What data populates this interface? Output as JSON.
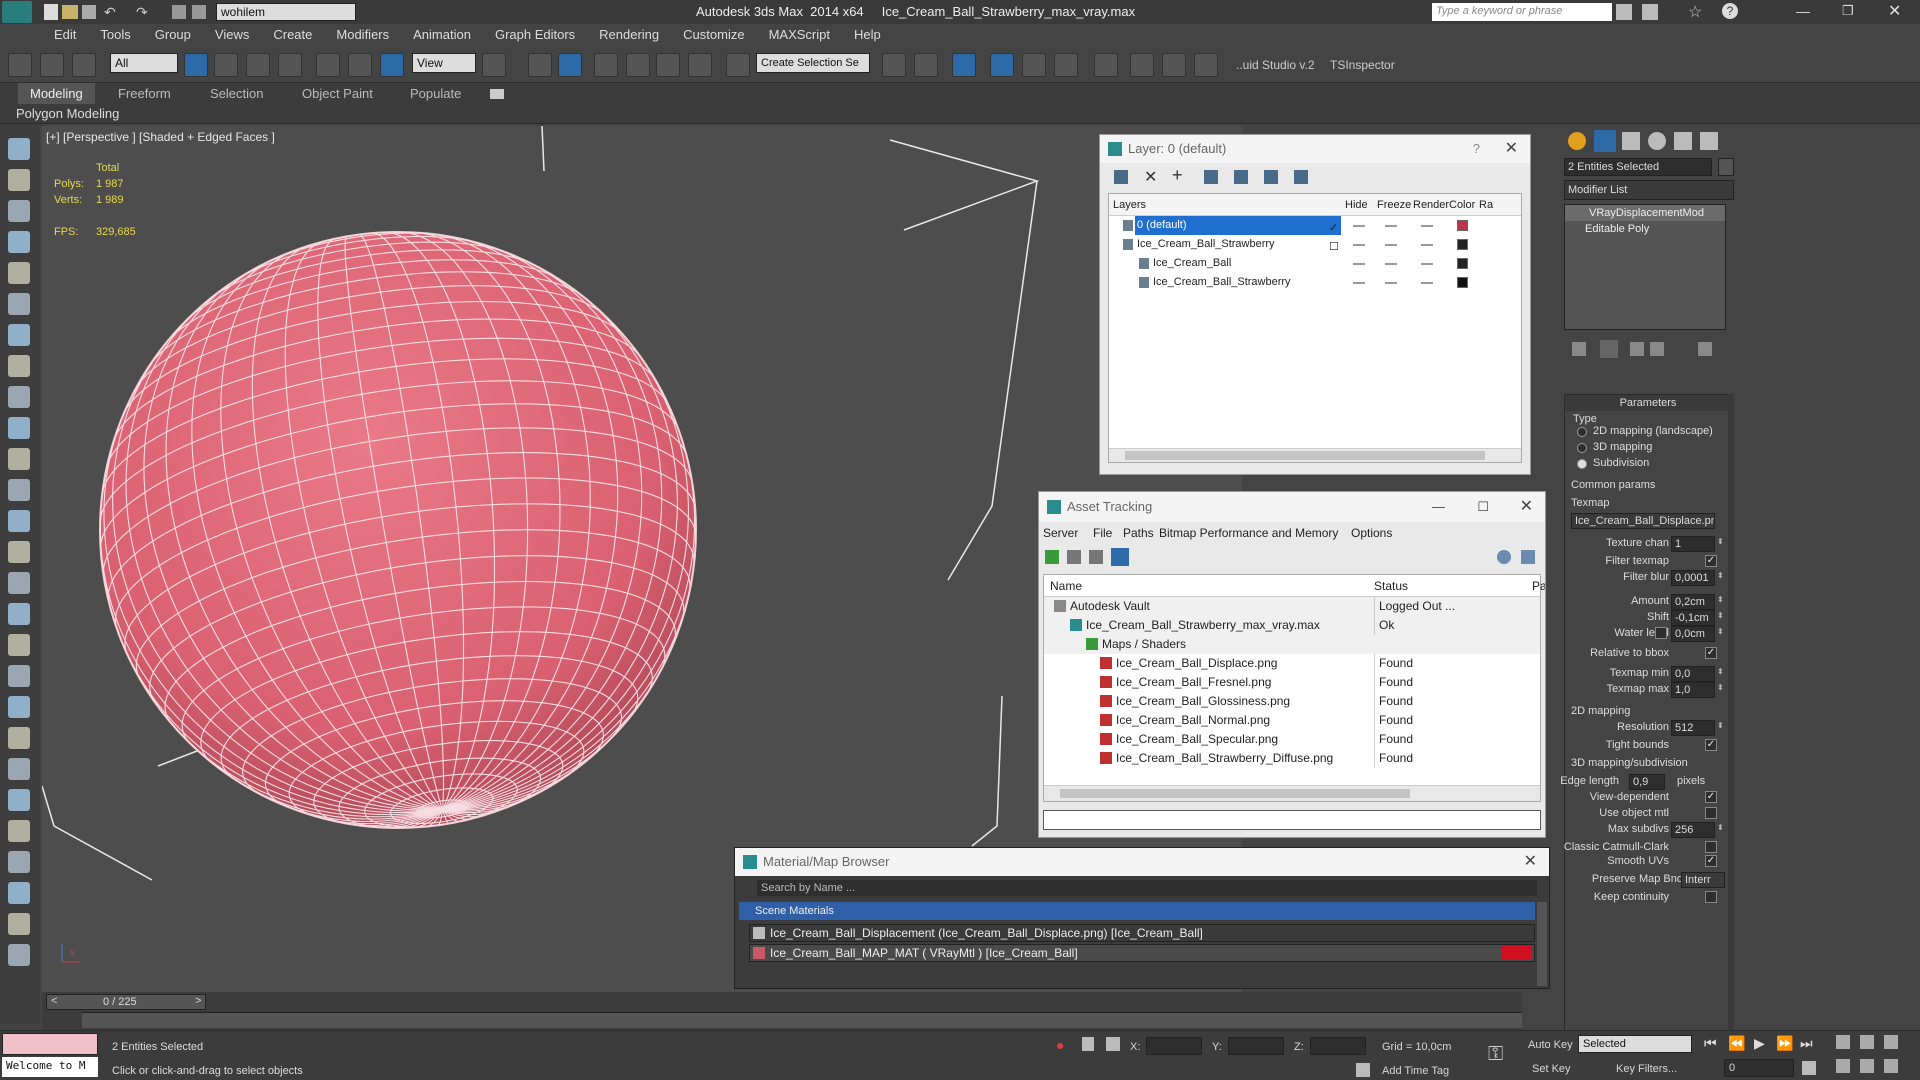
{
  "app": {
    "title": "Autodesk 3ds Max  2014 x64     Ice_Cream_Ball_Strawberry_max_vray.max",
    "workspace": "wohilem",
    "search_placeholder": "Type a keyword or phrase"
  },
  "menu": [
    "Edit",
    "Tools",
    "Group",
    "Views",
    "Create",
    "Modifiers",
    "Animation",
    "Graph Editors",
    "Rendering",
    "Customize",
    "MAXScript",
    "Help"
  ],
  "toolbar": {
    "selection_filter": "All",
    "ref_coord": "View",
    "named_selection": "Create Selection Se",
    "plugin_1": "..uid Studio v.2",
    "plugin_2": "TSInspector"
  },
  "ribbon": {
    "tabs": [
      "Modeling",
      "Freeform",
      "Selection",
      "Object Paint",
      "Populate"
    ],
    "active": "Modeling",
    "sub_label": "Polygon Modeling"
  },
  "viewport": {
    "label": "[+] [Perspective ] [Shaded + Edged Faces ]",
    "stats_header": "Total",
    "polys_label": "Polys:",
    "polys": "1 987",
    "verts_label": "Verts:",
    "verts": "1 989",
    "fps_label": "FPS:",
    "fps": "329,685",
    "object_color": "#e06a78"
  },
  "layers": {
    "title": "Layer: 0 (default)",
    "columns": [
      "Layers",
      "Hide",
      "Freeze",
      "Render",
      "Color",
      "Ra"
    ],
    "rows": [
      {
        "name": "0 (default)",
        "selected": true,
        "color": "#c0304a"
      },
      {
        "name": "Ice_Cream_Ball_Strawberry",
        "selected": false,
        "color": "#222222"
      },
      {
        "name": "Ice_Cream_Ball",
        "selected": false,
        "color": "#222222"
      },
      {
        "name": "Ice_Cream_Ball_Strawberry",
        "selected": false,
        "color": "#111111"
      }
    ]
  },
  "asset_tracking": {
    "title": "Asset Tracking",
    "menu": [
      "Server",
      "File",
      "Paths",
      "Bitmap Performance and Memory",
      "Options"
    ],
    "columns": [
      "Name",
      "Status",
      "Pa"
    ],
    "rows": [
      {
        "name": "Autodesk Vault",
        "status": "Logged Out ..."
      },
      {
        "name": "Ice_Cream_Ball_Strawberry_max_vray.max",
        "status": "Ok"
      },
      {
        "name": "Maps / Shaders",
        "status": ""
      },
      {
        "name": "Ice_Cream_Ball_Displace.png",
        "status": "Found"
      },
      {
        "name": "Ice_Cream_Ball_Fresnel.png",
        "status": "Found"
      },
      {
        "name": "Ice_Cream_Ball_Glossiness.png",
        "status": "Found"
      },
      {
        "name": "Ice_Cream_Ball_Normal.png",
        "status": "Found"
      },
      {
        "name": "Ice_Cream_Ball_Specular.png",
        "status": "Found"
      },
      {
        "name": "Ice_Cream_Ball_Strawberry_Diffuse.png",
        "status": "Found"
      }
    ]
  },
  "material_browser": {
    "title": "Material/Map Browser",
    "search_placeholder": "Search by Name ...",
    "group": "Scene Materials",
    "items": [
      "Ice_Cream_Ball_Displacement (Ice_Cream_Ball_Displace.png) [Ice_Cream_Ball]",
      "Ice_Cream_Ball_MAP_MAT  ( VRayMtl ) [Ice_Cream_Ball]"
    ]
  },
  "command_panel": {
    "selection": "2 Entities Selected",
    "modifier_list": "Modifier List",
    "stack": [
      "VRayDisplacementMod",
      "Editable Poly"
    ],
    "params_header": "Parameters",
    "type_label": "Type",
    "type_options": [
      "2D mapping (landscape)",
      "3D mapping",
      "Subdivision"
    ],
    "type_selected": "Subdivision",
    "common_label": "Common params",
    "texmap_label": "Texmap",
    "texmap": "Ice_Cream_Ball_Displace.png)",
    "texture_chan_label": "Texture chan",
    "texture_chan": "1",
    "filter_texmap_label": "Filter texmap",
    "filter_blur_label": "Filter blur",
    "filter_blur": "0,0001",
    "amount_label": "Amount",
    "amount": "0,2cm",
    "shift_label": "Shift",
    "shift": "-0,1cm",
    "water_label": "Water level",
    "water": "0,0cm",
    "relative_label": "Relative to bbox",
    "texmap_min_label": "Texmap min",
    "texmap_min": "0,0",
    "texmap_max_label": "Texmap max",
    "texmap_max": "1,0",
    "mapping2d_label": "2D mapping",
    "resolution_label": "Resolution",
    "resolution": "512",
    "tight_label": "Tight bounds",
    "mapping3d_label": "3D mapping/subdivision",
    "edge_label": "Edge length",
    "edge": "0,9",
    "pixels": "pixels",
    "view_dep_label": "View-dependent",
    "use_obj_label": "Use object mtl",
    "max_subdivs_label": "Max subdivs",
    "max_subdivs": "256",
    "catmull_label": "Classic Catmull-Clark",
    "smooth_label": "Smooth UVs",
    "preserve_label": "Preserve Map Bnd",
    "preserve": "Interr",
    "keep_label": "Keep continuity"
  },
  "timeline": {
    "frame": "0 / 225"
  },
  "status": {
    "maxscript": "Welcome to M",
    "selected": "2 Entities Selected",
    "prompt": "Click or click-and-drag to select objects",
    "x_label": "X:",
    "y_label": "Y:",
    "z_label": "Z:",
    "grid": "Grid = 10,0cm",
    "add_time_tag": "Add Time Tag",
    "auto_key": "Auto Key",
    "set_key": "Set Key",
    "key_mode": "Selected",
    "key_filters": "Key Filters...",
    "frame_value": "0"
  }
}
